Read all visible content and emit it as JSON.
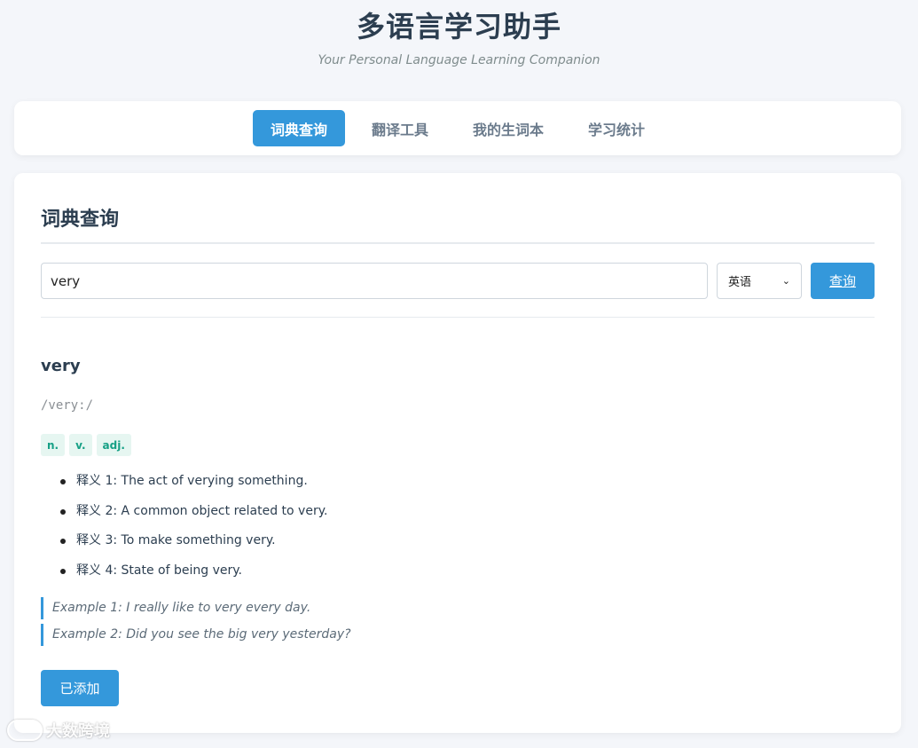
{
  "header": {
    "title": "多语言学习助手",
    "subtitle": "Your Personal Language Learning Companion"
  },
  "nav": {
    "tabs": [
      {
        "label": "词典查询",
        "active": true
      },
      {
        "label": "翻译工具",
        "active": false
      },
      {
        "label": "我的生词本",
        "active": false
      },
      {
        "label": "学习统计",
        "active": false
      }
    ]
  },
  "dictionary": {
    "section_title": "词典查询",
    "search_value": "very",
    "language_selected": "英语",
    "search_button": "查询",
    "result": {
      "word": "very",
      "phonetic": "/very:/",
      "pos_tags": [
        "n.",
        "v.",
        "adj."
      ],
      "definitions": [
        "释义 1: The act of verying something.",
        "释义 2: A common object related to very.",
        "释义 3: To make something very.",
        "释义 4: State of being very."
      ],
      "examples": [
        "Example 1: I really like to very every day.",
        "Example 2: Did you see the big very yesterday?"
      ],
      "add_button": "已添加"
    }
  },
  "watermark": {
    "text": "大数跨境"
  },
  "colors": {
    "accent": "#3498db",
    "pos_tag_bg": "#e6f6f1",
    "pos_tag_text": "#16a085",
    "title": "#2c3e50"
  }
}
